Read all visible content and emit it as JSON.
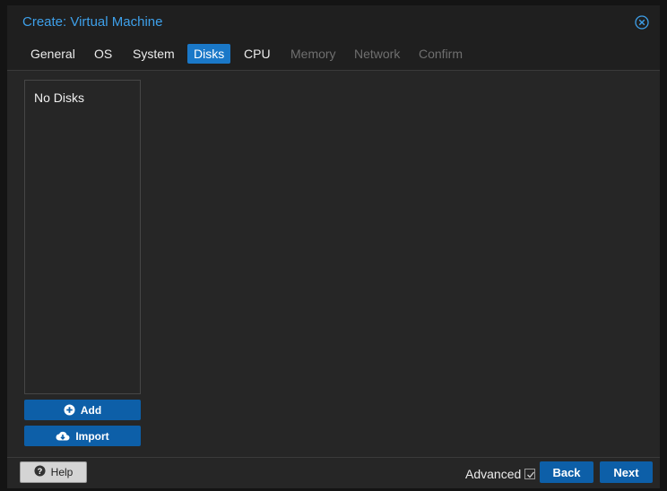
{
  "window": {
    "title": "Create: Virtual Machine",
    "close_icon": "close-circle-icon"
  },
  "tabs": [
    {
      "label": "General",
      "state": "normal"
    },
    {
      "label": "OS",
      "state": "normal"
    },
    {
      "label": "System",
      "state": "normal"
    },
    {
      "label": "Disks",
      "state": "active"
    },
    {
      "label": "CPU",
      "state": "normal"
    },
    {
      "label": "Memory",
      "state": "disabled"
    },
    {
      "label": "Network",
      "state": "disabled"
    },
    {
      "label": "Confirm",
      "state": "disabled"
    }
  ],
  "disks": {
    "empty_text": "No Disks",
    "add_label": "Add",
    "add_icon": "plus-circle-icon",
    "import_label": "Import",
    "import_icon": "cloud-download-icon"
  },
  "footer": {
    "help_label": "Help",
    "help_icon": "question-circle-icon",
    "advanced_label": "Advanced",
    "advanced_checked": true,
    "back_label": "Back",
    "next_label": "Next"
  },
  "colors": {
    "accent": "#1a78c8",
    "button_blue": "#0d5fa8",
    "title_blue": "#3ea0ea",
    "background": "#262626"
  }
}
